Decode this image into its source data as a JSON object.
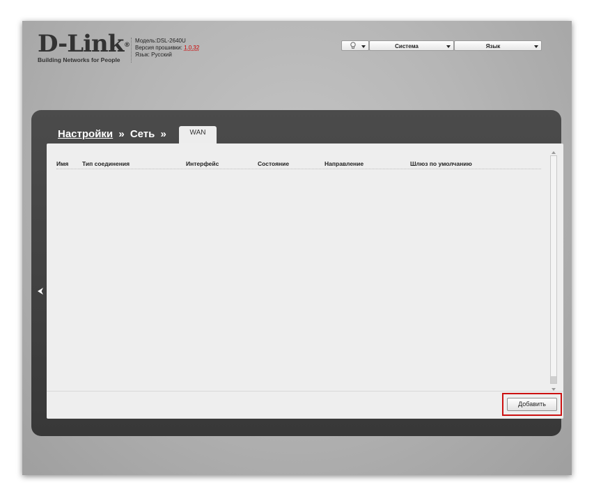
{
  "header": {
    "logo": {
      "brand": "D-Link",
      "registered": "®",
      "tagline": "Building Networks for People"
    },
    "device": {
      "model_label": "Модель:",
      "model_value": "DSL-2640U",
      "firmware_label": "Версия прошивки:",
      "firmware_value": "1.0.32",
      "language_label": "Язык:",
      "language_value": "Русский"
    },
    "menus": {
      "hints_icon": "lightbulb-icon",
      "system_label": "Система",
      "language_label": "Язык"
    }
  },
  "breadcrumb": {
    "settings": "Настройки",
    "network": "Сеть",
    "separator": "»"
  },
  "tab": {
    "label": "WAN"
  },
  "table": {
    "columns": [
      "Имя",
      "Тип соединения",
      "Интерфейс",
      "Состояние",
      "Направление",
      "Шлюз по умолчанию"
    ],
    "rows": []
  },
  "actions": {
    "add_label": "Добавить"
  },
  "colors": {
    "highlight": "#cc1010",
    "panel": "#404040",
    "content": "#eeeeee",
    "firmware": "#cc0000"
  }
}
